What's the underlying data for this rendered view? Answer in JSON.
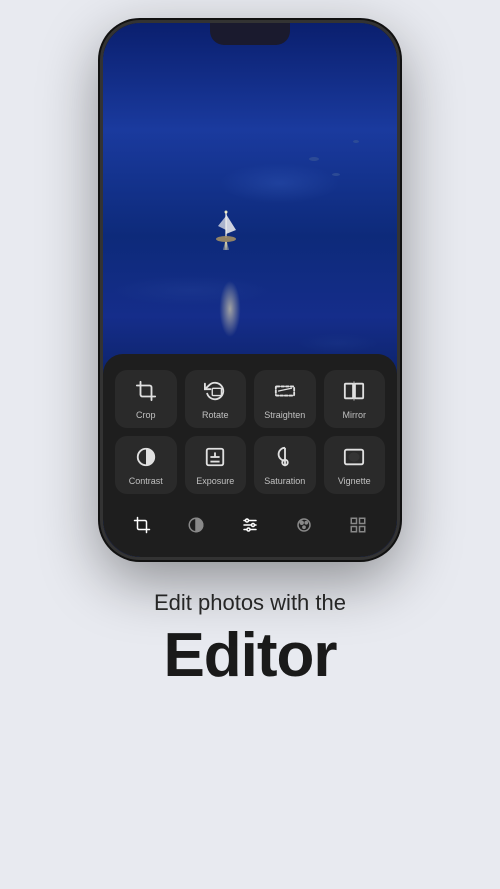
{
  "page": {
    "background_color": "#e8eaf0"
  },
  "phone": {
    "tools": [
      {
        "id": "crop",
        "label": "Crop",
        "icon": "crop"
      },
      {
        "id": "rotate",
        "label": "Rotate",
        "icon": "rotate"
      },
      {
        "id": "straighten",
        "label": "Straighten",
        "icon": "straighten"
      },
      {
        "id": "mirror",
        "label": "Mirror",
        "icon": "mirror"
      },
      {
        "id": "contrast",
        "label": "Contrast",
        "icon": "contrast"
      },
      {
        "id": "exposure",
        "label": "Exposure",
        "icon": "exposure"
      },
      {
        "id": "saturation",
        "label": "Saturation",
        "icon": "saturation"
      },
      {
        "id": "vignette",
        "label": "Vignette",
        "icon": "vignette"
      }
    ],
    "bottom_bar": [
      {
        "id": "crop-bottom",
        "icon": "crop",
        "active": true
      },
      {
        "id": "filter",
        "icon": "filter"
      },
      {
        "id": "adjust",
        "icon": "adjust",
        "active": true
      },
      {
        "id": "paint",
        "icon": "paint"
      },
      {
        "id": "grid",
        "icon": "grid"
      }
    ]
  },
  "text": {
    "subtitle": "Edit photos with the",
    "title": "Editor"
  }
}
